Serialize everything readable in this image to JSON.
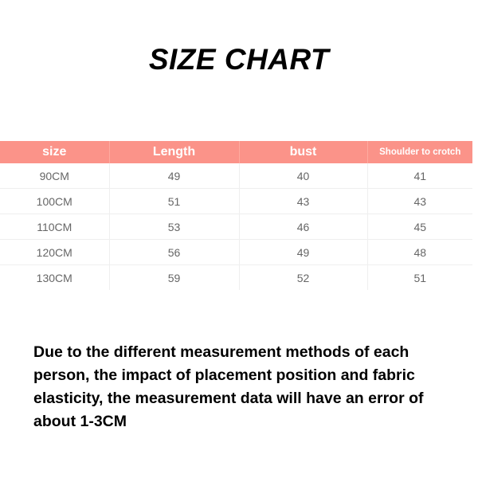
{
  "page": {
    "title": "SIZE CHART",
    "background_color": "#ffffff",
    "accent_color": "#fb9389",
    "body_text_color": "#666666"
  },
  "chart_data": {
    "type": "table",
    "title": "SIZE CHART",
    "columns": [
      "size",
      "Length",
      "bust",
      "Shoulder to crotch"
    ],
    "rows": [
      [
        "90CM",
        "49",
        "40",
        "41"
      ],
      [
        "100CM",
        "51",
        "43",
        "43"
      ],
      [
        "110CM",
        "53",
        "46",
        "45"
      ],
      [
        "120CM",
        "56",
        "49",
        "48"
      ],
      [
        "130CM",
        "59",
        "52",
        "51"
      ]
    ],
    "units": "CM",
    "header_background": "#fb9389",
    "header_text_color": "#ffffff",
    "grid": true,
    "note": "Due to the different measurement methods of each person, the impact of placement position and fabric elasticity, the measurement data will have an error of about 1-3CM"
  },
  "table": {
    "headers": {
      "size": "size",
      "length": "Length",
      "bust": "bust",
      "shoulder_to_crotch": "Shoulder to crotch"
    },
    "rows": [
      {
        "size": "90CM",
        "length": "49",
        "bust": "40",
        "shoulder_to_crotch": "41"
      },
      {
        "size": "100CM",
        "length": "51",
        "bust": "43",
        "shoulder_to_crotch": "43"
      },
      {
        "size": "110CM",
        "length": "53",
        "bust": "46",
        "shoulder_to_crotch": "45"
      },
      {
        "size": "120CM",
        "length": "56",
        "bust": "49",
        "shoulder_to_crotch": "48"
      },
      {
        "size": "130CM",
        "length": "59",
        "bust": "52",
        "shoulder_to_crotch": "51"
      }
    ]
  },
  "disclaimer": {
    "text": "Due to the different measurement methods of each person, the impact of placement position and fabric elasticity, the measurement data will have an error of about 1-3CM"
  }
}
